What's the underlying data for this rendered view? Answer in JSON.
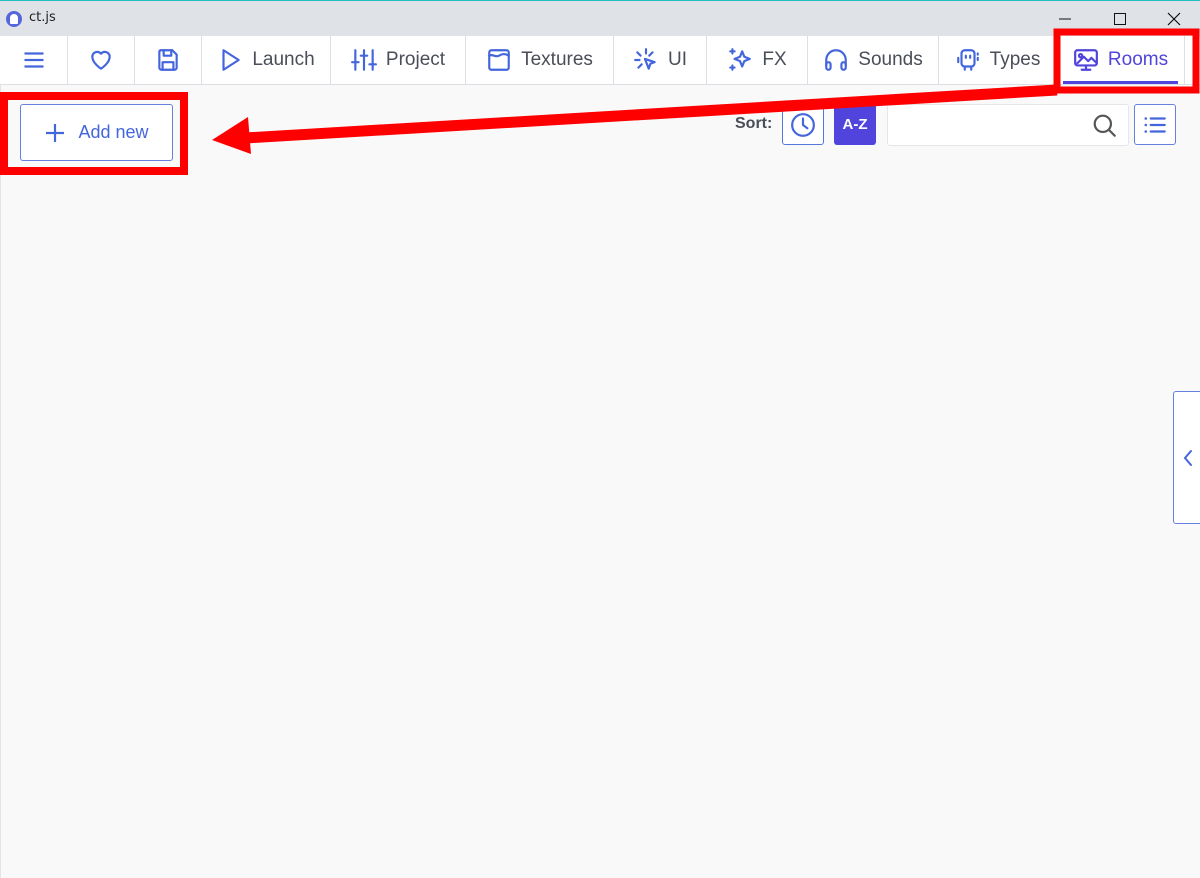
{
  "window": {
    "title": "ct.js",
    "controls": [
      "minimize",
      "maximize",
      "close"
    ]
  },
  "tabs": [
    {
      "name": "menu",
      "label": "",
      "icon": "hamburger-icon"
    },
    {
      "name": "patrons",
      "label": "",
      "icon": "heart-icon"
    },
    {
      "name": "save",
      "label": "",
      "icon": "save-icon"
    },
    {
      "name": "launch",
      "label": "Launch",
      "icon": "play-icon"
    },
    {
      "name": "project",
      "label": "Project",
      "icon": "sliders-icon"
    },
    {
      "name": "textures",
      "label": "Textures",
      "icon": "texture-icon"
    },
    {
      "name": "ui",
      "label": "UI",
      "icon": "cursor-click-icon"
    },
    {
      "name": "fx",
      "label": "FX",
      "icon": "sparkles-icon"
    },
    {
      "name": "sounds",
      "label": "Sounds",
      "icon": "headphones-icon"
    },
    {
      "name": "types",
      "label": "Types",
      "icon": "robot-icon"
    },
    {
      "name": "rooms",
      "label": "Rooms",
      "icon": "monitor-image-icon",
      "active": true
    }
  ],
  "toolbar": {
    "add_new_label": "Add new",
    "sort_label": "Sort:",
    "sort_time_icon": "clock-icon",
    "sort_az_label": "A-Z",
    "sort_active": "A-Z",
    "search_placeholder": "",
    "search_value": "",
    "view_toggle_icon": "list-icon"
  },
  "sidebar_toggle_icon": "chevron-left-icon",
  "annotations": {
    "color": "#ff0000",
    "highlights": [
      "rooms-tab",
      "add-new-button"
    ],
    "arrow": "from rooms-tab to add-new-button"
  },
  "colors": {
    "accent": "#5144dd",
    "icon_blue": "#4466dd",
    "text": "#4a4e58",
    "background": "#f9f9fa",
    "titlebar": "#dfe2e6"
  }
}
